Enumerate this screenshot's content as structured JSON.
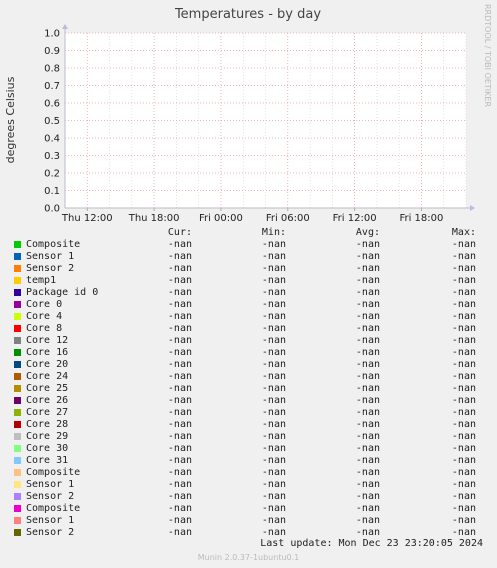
{
  "chart_data": {
    "type": "line",
    "title": "Temperatures - by day",
    "ylabel": "degrees Celsius",
    "xlabel": "",
    "ylim": [
      0.0,
      1.0
    ],
    "y_ticks": [
      "0.0",
      "0.1",
      "0.2",
      "0.3",
      "0.4",
      "0.5",
      "0.6",
      "0.7",
      "0.8",
      "0.9",
      "1.0"
    ],
    "x_ticks": [
      "Thu 12:00",
      "Thu 18:00",
      "Fri 00:00",
      "Fri 06:00",
      "Fri 12:00",
      "Fri 18:00"
    ],
    "grid": true,
    "series_values": "no data (all -nan)"
  },
  "side_text": "RRDTOOL / TOBI OETIKER",
  "legend": {
    "headers": {
      "cur": "Cur:",
      "min": "Min:",
      "avg": "Avg:",
      "max": "Max:"
    },
    "rows": [
      {
        "name": "Composite",
        "color": "#00cc00",
        "cur": "-nan",
        "min": "-nan",
        "avg": "-nan",
        "max": "-nan"
      },
      {
        "name": "Sensor 1",
        "color": "#0066b3",
        "cur": "-nan",
        "min": "-nan",
        "avg": "-nan",
        "max": "-nan"
      },
      {
        "name": "Sensor 2",
        "color": "#ff8000",
        "cur": "-nan",
        "min": "-nan",
        "avg": "-nan",
        "max": "-nan"
      },
      {
        "name": "temp1",
        "color": "#ffcc00",
        "cur": "-nan",
        "min": "-nan",
        "avg": "-nan",
        "max": "-nan"
      },
      {
        "name": "Package id 0",
        "color": "#330099",
        "cur": "-nan",
        "min": "-nan",
        "avg": "-nan",
        "max": "-nan"
      },
      {
        "name": "Core 0",
        "color": "#990099",
        "cur": "-nan",
        "min": "-nan",
        "avg": "-nan",
        "max": "-nan"
      },
      {
        "name": "Core 4",
        "color": "#ccff00",
        "cur": "-nan",
        "min": "-nan",
        "avg": "-nan",
        "max": "-nan"
      },
      {
        "name": "Core 8",
        "color": "#ff0000",
        "cur": "-nan",
        "min": "-nan",
        "avg": "-nan",
        "max": "-nan"
      },
      {
        "name": "Core 12",
        "color": "#808080",
        "cur": "-nan",
        "min": "-nan",
        "avg": "-nan",
        "max": "-nan"
      },
      {
        "name": "Core 16",
        "color": "#008f00",
        "cur": "-nan",
        "min": "-nan",
        "avg": "-nan",
        "max": "-nan"
      },
      {
        "name": "Core 20",
        "color": "#00487d",
        "cur": "-nan",
        "min": "-nan",
        "avg": "-nan",
        "max": "-nan"
      },
      {
        "name": "Core 24",
        "color": "#b35a00",
        "cur": "-nan",
        "min": "-nan",
        "avg": "-nan",
        "max": "-nan"
      },
      {
        "name": "Core 25",
        "color": "#b38f00",
        "cur": "-nan",
        "min": "-nan",
        "avg": "-nan",
        "max": "-nan"
      },
      {
        "name": "Core 26",
        "color": "#6b006b",
        "cur": "-nan",
        "min": "-nan",
        "avg": "-nan",
        "max": "-nan"
      },
      {
        "name": "Core 27",
        "color": "#8fb300",
        "cur": "-nan",
        "min": "-nan",
        "avg": "-nan",
        "max": "-nan"
      },
      {
        "name": "Core 28",
        "color": "#b30000",
        "cur": "-nan",
        "min": "-nan",
        "avg": "-nan",
        "max": "-nan"
      },
      {
        "name": "Core 29",
        "color": "#bebebe",
        "cur": "-nan",
        "min": "-nan",
        "avg": "-nan",
        "max": "-nan"
      },
      {
        "name": "Core 30",
        "color": "#80ff80",
        "cur": "-nan",
        "min": "-nan",
        "avg": "-nan",
        "max": "-nan"
      },
      {
        "name": "Core 31",
        "color": "#80c9ff",
        "cur": "-nan",
        "min": "-nan",
        "avg": "-nan",
        "max": "-nan"
      },
      {
        "name": "Composite",
        "color": "#ffc080",
        "cur": "-nan",
        "min": "-nan",
        "avg": "-nan",
        "max": "-nan"
      },
      {
        "name": "Sensor 1",
        "color": "#ffe680",
        "cur": "-nan",
        "min": "-nan",
        "avg": "-nan",
        "max": "-nan"
      },
      {
        "name": "Sensor 2",
        "color": "#aa80ff",
        "cur": "-nan",
        "min": "-nan",
        "avg": "-nan",
        "max": "-nan"
      },
      {
        "name": "Composite",
        "color": "#ee00cc",
        "cur": "-nan",
        "min": "-nan",
        "avg": "-nan",
        "max": "-nan"
      },
      {
        "name": "Sensor 1",
        "color": "#ff8080",
        "cur": "-nan",
        "min": "-nan",
        "avg": "-nan",
        "max": "-nan"
      },
      {
        "name": "Sensor 2",
        "color": "#666600",
        "cur": "-nan",
        "min": "-nan",
        "avg": "-nan",
        "max": "-nan"
      }
    ]
  },
  "last_update": "Last update: Mon Dec 23 23:20:05 2024",
  "munin_version": "Munin 2.0.37-1ubuntu0.1"
}
